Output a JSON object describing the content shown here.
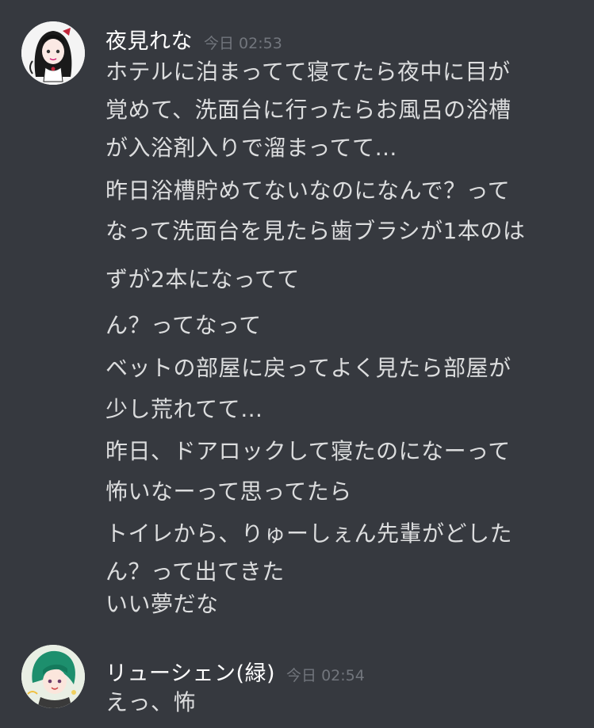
{
  "messages": [
    {
      "username": "夜見れな",
      "timestamp": "今日 02:53",
      "lines": [
        "ホテルに泊まってて寝てたら夜中に目が",
        "覚めて、洗面台に行ったらお風呂の浴槽",
        "が入浴剤入りで溜まってて…",
        "昨日浴槽貯めてないなのになんで？って",
        "なって洗面台を見たら歯ブラシが1本のは",
        "ずが2本になってて",
        "ん？ってなって",
        "ベットの部屋に戻ってよく見たら部屋が",
        "少し荒れてて…",
        "昨日、ドアロックして寝たのになーって",
        "怖いなーって思ってたら",
        "トイレから、りゅーしぇん先輩がどした",
        "ん？って出てきた",
        "いい夢だな"
      ]
    },
    {
      "username": "リューシェン(緑)",
      "timestamp": "今日 02:54",
      "lines": [
        "えっ、怖"
      ]
    }
  ],
  "colors": {
    "background": "#36393f",
    "username": "#ffffff",
    "timestamp": "#72767d",
    "text": "#dcddde"
  }
}
